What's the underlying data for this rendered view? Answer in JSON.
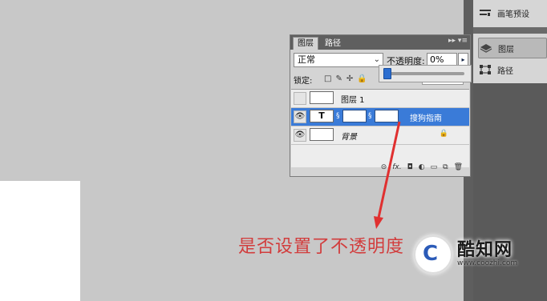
{
  "dock": {
    "items": [
      {
        "label": "画笔预设",
        "icon": "brush-presets-icon"
      },
      {
        "label": "图层",
        "icon": "layers-icon"
      },
      {
        "label": "路径",
        "icon": "paths-icon"
      }
    ]
  },
  "panel": {
    "tabs": [
      {
        "label": "图层"
      },
      {
        "label": "路径"
      }
    ],
    "blend_mode": "正常",
    "opacity_label": "不透明度:",
    "opacity_value": "0%",
    "opacity_slider_fraction": 0.0,
    "lock_label": "锁定:",
    "layers": [
      {
        "name": "图层 1",
        "visible": false,
        "selected": false
      },
      {
        "name": "搜狗指南",
        "visible": true,
        "selected": true,
        "type_glyph": "T"
      },
      {
        "name": "背景",
        "visible": true,
        "selected": false,
        "locked": true
      }
    ]
  },
  "caption": "是否设置了不透明度",
  "watermark": {
    "brand": "酷知网",
    "url": "www.coozhi.com"
  },
  "colors": {
    "selection": "#3a7bd8",
    "annotation": "#d23c3c"
  }
}
